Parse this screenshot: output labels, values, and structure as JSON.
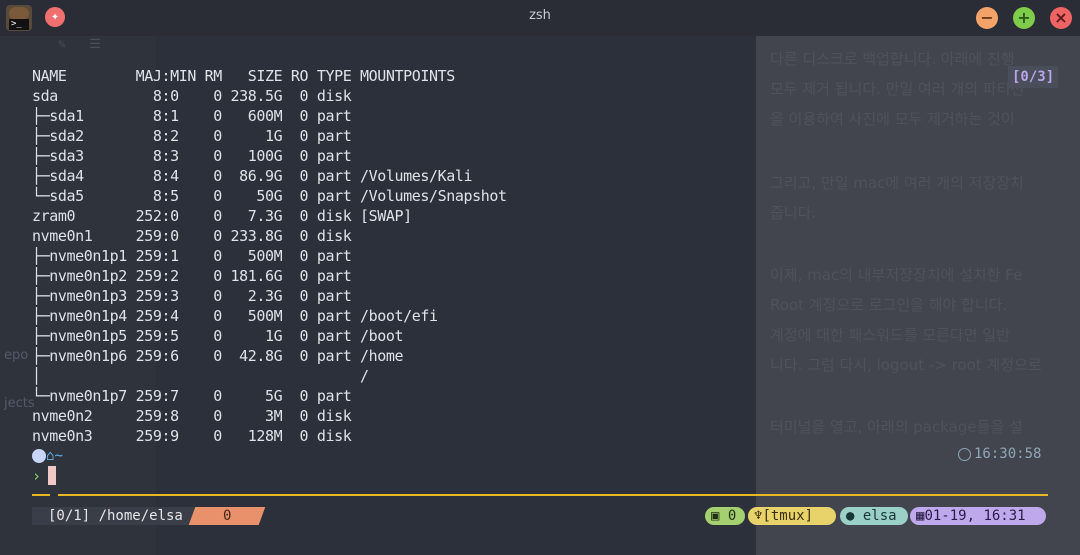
{
  "window": {
    "title": "zsh"
  },
  "terminal": {
    "lines": [
      "NAME        MAJ:MIN RM   SIZE RO TYPE MOUNTPOINTS",
      "sda           8:0    0 238.5G  0 disk",
      "├─sda1        8:1    0   600M  0 part",
      "├─sda2        8:2    0     1G  0 part",
      "├─sda3        8:3    0   100G  0 part",
      "├─sda4        8:4    0  86.9G  0 part /Volumes/Kali",
      "└─sda5        8:5    0    50G  0 part /Volumes/Snapshot",
      "zram0       252:0    0   7.3G  0 disk [SWAP]",
      "nvme0n1     259:0    0 233.8G  0 disk",
      "├─nvme0n1p1 259:1    0   500M  0 part",
      "├─nvme0n1p2 259:2    0 181.6G  0 part",
      "├─nvme0n1p3 259:3    0   2.3G  0 part",
      "├─nvme0n1p4 259:4    0   500M  0 part /boot/efi",
      "├─nvme0n1p5 259:5    0     1G  0 part /boot",
      "├─nvme0n1p6 259:6    0  42.8G  0 part /home",
      "│                                     /",
      "└─nvme0n1p7 259:7    0     5G  0 part",
      "nvme0n2     259:8    0     3M  0 disk",
      "nvme0n3     259:9    0   128M  0 disk"
    ],
    "counter": "[0/3]",
    "prompt_dir": "~",
    "prompt_chevron": "›",
    "clock": "16:30:58"
  },
  "statusbar": {
    "path": "[0/1] /home/elsa",
    "window_index": "0",
    "pane_count": "0",
    "session": "[tmux]",
    "user": "elsa",
    "datetime": "01-19, 16:31"
  },
  "background": {
    "left_fragments": [
      "epo",
      "jects"
    ],
    "right_lines": [
      "다른 디스크로 백업합니다. 아래에 진행",
      "모두 제거 됩니다. 만일 여러 개의 파티션",
      "을 이용하여 사진에 모두 제거하는 것이",
      "그리고, 만일 mac에 여러 개의 저장장치",
      "줍니다.",
      "이제, mac의 내부저장장치에 설치한 Fe",
      "Root 계정으로 로그인을 해야 합니다.",
      "계정에 대한 패스워드를 모른다면 일반",
      "니다.  그럼 다시, logout -> root 계정으로",
      "터미널을 열고,  아래의 package들을 설"
    ]
  },
  "icons": {
    "app": "terminal-app-icon",
    "pin": "pin-icon",
    "minimize": "minimize-icon",
    "maximize": "maximize-icon",
    "close": "close-icon",
    "clock": "clock-icon"
  },
  "colors": {
    "accent_rule": "#e8b820",
    "prompt": "#5fb4ea",
    "chevron": "#8ad46a"
  }
}
